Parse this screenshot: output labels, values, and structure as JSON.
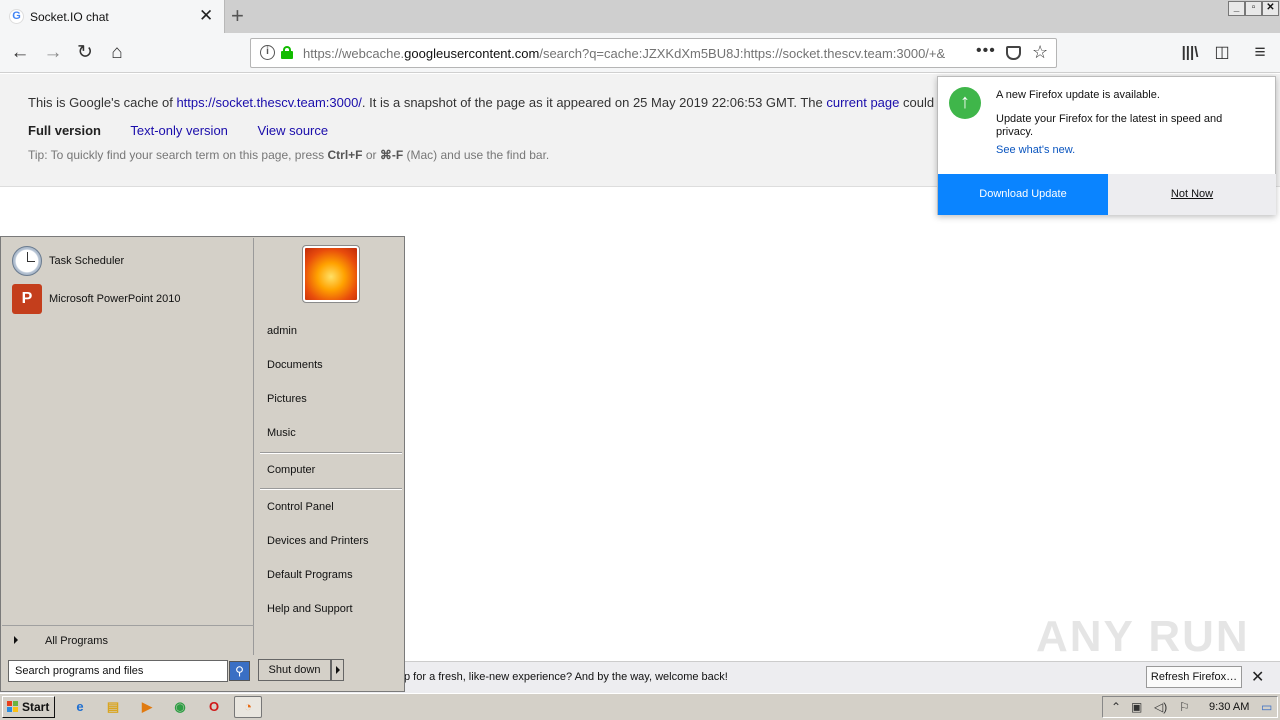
{
  "browser": {
    "tab_title": "Socket.IO chat",
    "favicon_letter": "G",
    "url_prefix": "https://webcache.",
    "url_domain": "googleusercontent.com",
    "url_rest": "/search?q=cache:JZXKdXm5BU8J:https://socket.thescv.team:3000/+&",
    "more_glyph": "•••"
  },
  "cache_banner": {
    "text_before": "This is Google's cache of ",
    "cached_link": "https://socket.thescv.team:3000/",
    "text_middle": ". It is a snapshot of the page as it appeared on 25 May 2019 22:06:53 GMT. The ",
    "current_link": "current page",
    "text_after": " could",
    "full_version": "Full version",
    "text_only": "Text-only version",
    "view_source": "View source",
    "tip_before": "Tip: To quickly find your search term on this page, press ",
    "tip_key1": "Ctrl+F",
    "tip_or": " or ",
    "tip_key2": "⌘-F",
    "tip_after": " (Mac) and use the find bar."
  },
  "update_panel": {
    "title": "A new Firefox update is available.",
    "message": "Update your Firefox for the latest in speed and privacy.",
    "link": "See what's new.",
    "download_button": "Download Update",
    "not_now_button": "Not Now",
    "accent_color": "#0a84ff"
  },
  "notification_bar": {
    "text": "p for a fresh, like-new experience? And by the way, welcome back!",
    "refresh_button": "Refresh Firefox…"
  },
  "watermark": "ANY RUN",
  "start_menu": {
    "pinned": [
      {
        "label": "Task Scheduler",
        "icon": "clock-icon"
      },
      {
        "label": "Microsoft PowerPoint 2010",
        "icon": "powerpoint-icon"
      }
    ],
    "all_programs": "All Programs",
    "search_placeholder": "Search programs and files",
    "right_items": {
      "user": "admin",
      "documents": "Documents",
      "pictures": "Pictures",
      "music": "Music",
      "computer": "Computer",
      "control_panel": "Control Panel",
      "devices": "Devices and Printers",
      "default_programs": "Default Programs",
      "help": "Help and Support"
    },
    "shutdown": "Shut down"
  },
  "taskbar": {
    "start_label": "Start",
    "clock": "9:30 AM"
  }
}
